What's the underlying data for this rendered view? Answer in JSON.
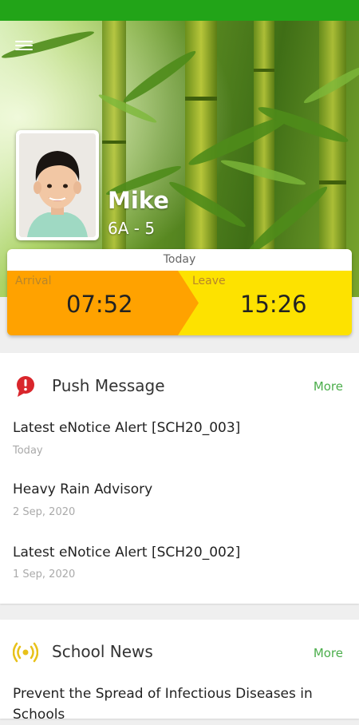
{
  "student": {
    "name": "Mike",
    "class": "6A - 5"
  },
  "attendance": {
    "day_label": "Today",
    "arrival_label": "Arrival",
    "arrival_time": "07:52",
    "leave_label": "Leave",
    "leave_time": "15:26"
  },
  "push_message": {
    "title": "Push Message",
    "more": "More",
    "items": [
      {
        "title": "Latest eNotice Alert [SCH20_003]",
        "date": "Today"
      },
      {
        "title": "Heavy Rain Advisory",
        "date": "2 Sep, 2020"
      },
      {
        "title": "Latest eNotice Alert [SCH20_002]",
        "date": "1 Sep, 2020"
      }
    ]
  },
  "school_news": {
    "title": "School News",
    "more": "More",
    "items": [
      {
        "title": "Prevent the Spread of Infectious Diseases in Schools"
      }
    ]
  },
  "colors": {
    "status_bar": "#22a418",
    "arrival": "#ffa200",
    "leave": "#fde200",
    "more_link": "#4cae4c",
    "alert_icon": "#d9262c",
    "news_icon": "#e8c11a"
  },
  "icons": {
    "menu": "hamburger-menu-icon",
    "push": "alert-bubble-icon",
    "news": "broadcast-icon"
  }
}
